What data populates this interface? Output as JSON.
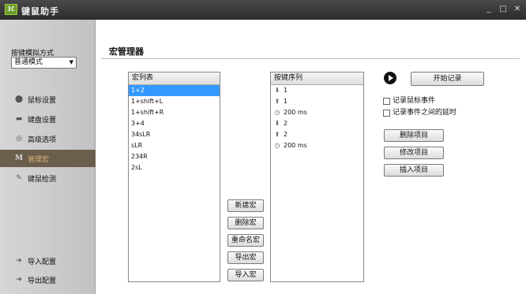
{
  "window": {
    "app_icon_text": "3C",
    "title": "键鼠助手",
    "minimize": "_",
    "maximize": "□",
    "close": "✕"
  },
  "sidebar": {
    "mode_label": "按键模拟方式",
    "mode_value": "普通模式",
    "items": [
      {
        "label": "鼠标设置",
        "icon": "mouse-icon",
        "glyph": "⬤"
      },
      {
        "label": "键盘设置",
        "icon": "keyboard-icon",
        "glyph": "▬"
      },
      {
        "label": "高级选项",
        "icon": "advanced-icon",
        "glyph": "◎"
      },
      {
        "label": "管理宏",
        "icon": "macro-icon",
        "glyph": "M",
        "active": true
      },
      {
        "label": "键鼠检测",
        "icon": "detect-icon",
        "glyph": "✎"
      },
      {
        "label": "导入配置",
        "icon": "import-icon",
        "glyph": "➜"
      },
      {
        "label": "导出配置",
        "icon": "export-icon",
        "glyph": "➜"
      }
    ]
  },
  "main": {
    "section_title": "宏管理器",
    "macro_list": {
      "header": "宏列表",
      "items": [
        "1+2",
        "1+shift+L",
        "1+shift+R",
        "3+4",
        "34sLR",
        "sLR",
        "234R",
        "2sL"
      ],
      "selected_index": 0
    },
    "key_sequence": {
      "header": "按键序列",
      "items": [
        {
          "icon": "arrow-down-icon",
          "glyph": "⬇",
          "text": "1"
        },
        {
          "icon": "arrow-up-icon",
          "glyph": "⬆",
          "text": "1"
        },
        {
          "icon": "clock-icon",
          "glyph": "◷",
          "text": "200 ms"
        },
        {
          "icon": "arrow-down-icon",
          "glyph": "⬇",
          "text": "2"
        },
        {
          "icon": "arrow-up-icon",
          "glyph": "⬆",
          "text": "2"
        },
        {
          "icon": "clock-icon",
          "glyph": "◷",
          "text": "200 ms"
        }
      ]
    },
    "macro_buttons": {
      "new": "新建宏",
      "delete": "删除宏",
      "rename": "重命名宏",
      "export": "导出宏",
      "import": "导入宏"
    },
    "record": {
      "start_label": "开始记录",
      "record_mouse_label": "记录鼠标事件",
      "record_delay_label": "记录事件之间的延时",
      "record_mouse_checked": false,
      "record_delay_checked": false
    },
    "item_buttons": {
      "delete": "删除项目",
      "modify": "修改项目",
      "insert": "插入项目"
    }
  }
}
